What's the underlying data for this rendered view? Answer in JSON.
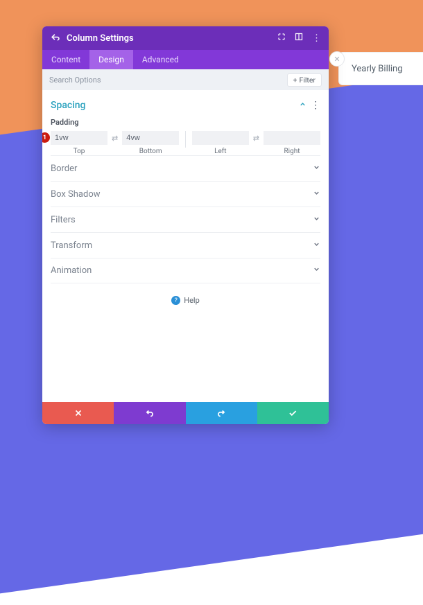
{
  "background": {
    "yearly_label": "Yearly Billing"
  },
  "panel": {
    "title": "Column Settings",
    "tabs": {
      "content": "Content",
      "design": "Design",
      "advanced": "Advanced",
      "active": "design"
    },
    "search": {
      "placeholder": "Search Options",
      "filter_label": "Filter"
    },
    "spacing": {
      "title": "Spacing",
      "padding_label": "Padding",
      "values": {
        "top": "1vw",
        "bottom": "4vw",
        "left": "",
        "right": ""
      },
      "labels": {
        "top": "Top",
        "bottom": "Bottom",
        "left": "Left",
        "right": "Right"
      }
    },
    "sections": {
      "border": "Border",
      "box_shadow": "Box Shadow",
      "filters": "Filters",
      "transform": "Transform",
      "animation": "Animation"
    },
    "help": "Help"
  },
  "annotation": "1"
}
